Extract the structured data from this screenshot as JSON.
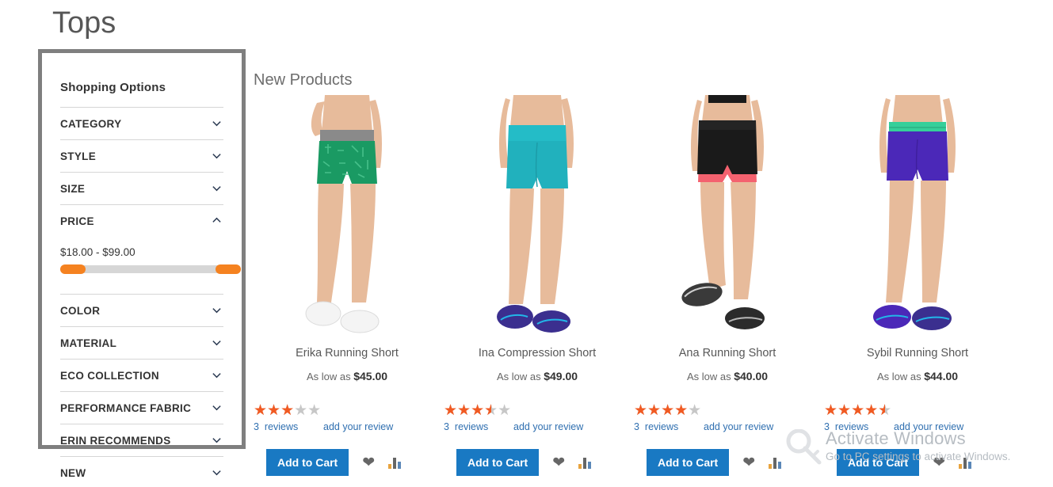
{
  "page": {
    "title": "Tops"
  },
  "sidebar": {
    "heading": "Shopping Options",
    "filters": [
      {
        "label": "CATEGORY",
        "expanded": false
      },
      {
        "label": "STYLE",
        "expanded": false
      },
      {
        "label": "SIZE",
        "expanded": false
      },
      {
        "label": "PRICE",
        "expanded": true
      },
      {
        "label": "COLOR",
        "expanded": false
      },
      {
        "label": "MATERIAL",
        "expanded": false
      },
      {
        "label": "ECO COLLECTION",
        "expanded": false
      },
      {
        "label": "PERFORMANCE FABRIC",
        "expanded": false
      },
      {
        "label": "ERIN RECOMMENDS",
        "expanded": false
      },
      {
        "label": "NEW",
        "expanded": false
      }
    ],
    "price": {
      "range_text": "$18.00 - $99.00",
      "min": "$18.00",
      "max": "$99.00",
      "handle_color": "#f58220",
      "track_color": "#d6d6d6"
    },
    "highlight_color": "#7f7f7f"
  },
  "main": {
    "section_title": "New Products",
    "labels": {
      "as_low_as": "As low as",
      "add_to_cart": "Add to Cart",
      "reviews": "reviews",
      "add_your_review": "add your review"
    },
    "accent_color": "#1979c3",
    "star_color": "#f15a22",
    "products": [
      {
        "name": "Erika Running Short",
        "price": "$45.00",
        "rating": 3,
        "rating_percent": 60,
        "review_count": "3",
        "image": {
          "short_color": "#1a9a63",
          "waist_color": "#8a8a8a",
          "shoe_color": "#f2f2f2",
          "skin_color": "#e7bb9b"
        }
      },
      {
        "name": "Ina Compression Short",
        "price": "$49.00",
        "rating": 3.5,
        "rating_percent": 70,
        "review_count": "3",
        "image": {
          "short_color": "#21b1bd",
          "waist_color": "#21b1bd",
          "shoe_color": "#3b2f8f",
          "skin_color": "#e7bb9b"
        }
      },
      {
        "name": "Ana Running Short",
        "price": "$40.00",
        "rating": 4,
        "rating_percent": 80,
        "review_count": "3",
        "image": {
          "short_color": "#1a1a1a",
          "waist_color": "#1a1a1a",
          "shoe_color": "#3a3a3a",
          "skin_color": "#e7bb9b",
          "liner_color": "#f4626f"
        }
      },
      {
        "name": "Sybil Running Short",
        "price": "$44.00",
        "rating": 4.5,
        "rating_percent": 90,
        "review_count": "3",
        "image": {
          "short_color": "#4b28b8",
          "waist_color": "#35cf9a",
          "shoe_color": "#3b2f8f",
          "skin_color": "#e7bb9b"
        }
      }
    ],
    "icons": {
      "wishlist": "heart-icon",
      "compare": "compare-bars-icon"
    }
  },
  "watermark": {
    "title": "Activate Windows",
    "subtitle": "Go to PC settings to activate Windows.",
    "color": "#b6bcc2"
  }
}
